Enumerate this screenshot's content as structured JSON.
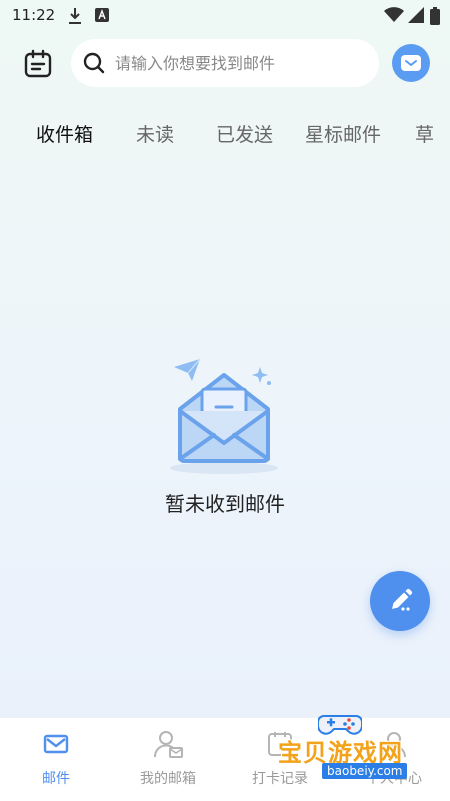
{
  "status_bar": {
    "time": "11:22",
    "icons": [
      "download-icon",
      "a-notification-icon",
      "wifi-icon",
      "signal-icon",
      "battery-icon"
    ]
  },
  "header": {
    "search_placeholder": "请输入你想要找到邮件",
    "calendar_icon": "calendar-icon",
    "avatar_icon": "mail-icon",
    "accent_color": "#5b9cf3"
  },
  "tabs": [
    {
      "label": "收件箱",
      "active": true
    },
    {
      "label": "未读",
      "active": false
    },
    {
      "label": "已发送",
      "active": false
    },
    {
      "label": "星标邮件",
      "active": false
    },
    {
      "label": "草",
      "active": false
    }
  ],
  "empty_state": {
    "message": "暂未收到邮件",
    "illustration": "open-envelope-icon"
  },
  "compose_button": {
    "icon": "pencil-icon",
    "color": "#4f8fee"
  },
  "bottom_nav": [
    {
      "label": "邮件",
      "icon": "mail-icon",
      "active": true
    },
    {
      "label": "我的邮箱",
      "icon": "user-mail-icon",
      "active": false
    },
    {
      "label": "打卡记录",
      "icon": "checkin-icon",
      "active": false
    },
    {
      "label": "个人中心",
      "icon": "profile-icon",
      "active": false
    }
  ],
  "watermark": {
    "title": "宝贝游戏网",
    "url": "baobeiy.com"
  }
}
